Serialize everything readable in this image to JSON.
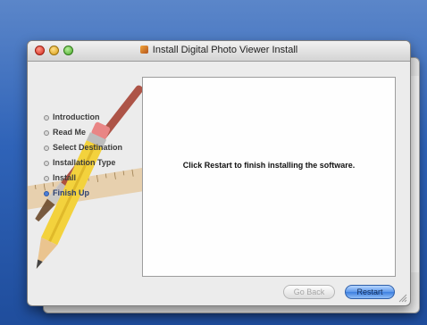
{
  "window": {
    "title": "Install Digital Photo Viewer Install"
  },
  "sidebar": {
    "steps": [
      {
        "label": "Introduction",
        "active": false
      },
      {
        "label": "Read Me",
        "active": false
      },
      {
        "label": "Select Destination",
        "active": false
      },
      {
        "label": "Installation Type",
        "active": false
      },
      {
        "label": "Install",
        "active": false
      },
      {
        "label": "Finish Up",
        "active": true
      }
    ]
  },
  "content": {
    "message": "Click Restart to finish installing the software."
  },
  "buttons": {
    "go_back": {
      "label": "Go Back",
      "enabled": false
    },
    "restart": {
      "label": "Restart",
      "enabled": true,
      "default": true
    }
  },
  "icons": {
    "close": "close-icon",
    "minimize": "minimize-icon",
    "zoom": "zoom-icon",
    "package": "package-icon",
    "resize": "resize-grip-icon"
  },
  "colors": {
    "desktop": "#2f63b8",
    "accent": "#3d7fe0",
    "active_step": "#4d7fd6"
  }
}
